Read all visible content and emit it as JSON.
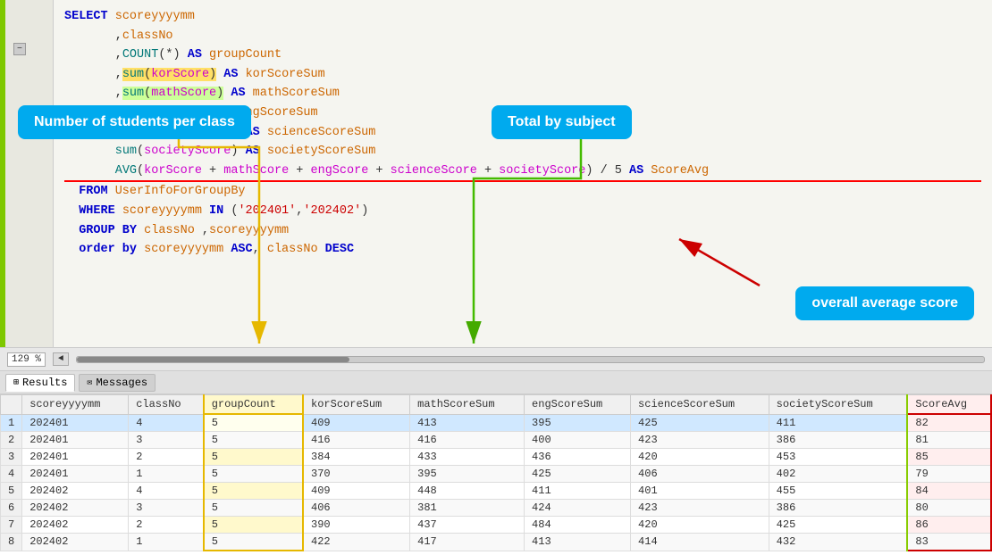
{
  "editor": {
    "zoom": "129 %",
    "sql_lines": [
      {
        "id": "l1",
        "indent": 4,
        "content": "SELECT scoreyyyymm"
      },
      {
        "id": "l2",
        "indent": 7,
        "content": ",classNo"
      },
      {
        "id": "l3",
        "indent": 7,
        "content": ",COUNT(*) AS groupCount"
      },
      {
        "id": "l4",
        "indent": 7,
        "content": ",sum(korScore) AS korScoreSum"
      },
      {
        "id": "l5",
        "indent": 7,
        "content": ",sum(mathScore) AS mathScoreSum"
      },
      {
        "id": "l6",
        "indent": 7,
        "content": ",sum(engScore) AS engScoreSum"
      },
      {
        "id": "l7",
        "indent": 7,
        "content": ",sum(scienceScore) AS scienceScoreSum"
      },
      {
        "id": "l8",
        "indent": 7,
        "content": ",sum(societyScore) AS societyScoreSum"
      },
      {
        "id": "l9",
        "indent": 7,
        "content": ",AVG(korScore + mathScore + engScore + scienceScore + societyScore) / 5 AS ScoreAvg"
      },
      {
        "id": "l10",
        "indent": 2,
        "content": "FROM UserInfoForGroupBy"
      },
      {
        "id": "l11",
        "indent": 2,
        "content": "WHERE scoreyyyymm IN ('202401','202402')"
      },
      {
        "id": "l12",
        "indent": 2,
        "content": "GROUP BY classNo ,scoreyyyymm"
      },
      {
        "id": "l13",
        "indent": 2,
        "content": "order by scoreyyyymm ASC, classNo DESC"
      }
    ]
  },
  "tooltips": {
    "students_per_class": "Number of students per class",
    "total_by_subject": "Total by subject",
    "overall_avg": "overall average score"
  },
  "tabs": {
    "results": "Results",
    "messages": "Messages"
  },
  "table": {
    "headers": [
      "scoreyyyymm",
      "classNo",
      "groupCount",
      "korScoreSum",
      "mathScoreSum",
      "engScoreSum",
      "scienceScoreSum",
      "societyScoreSum",
      "ScoreAvg"
    ],
    "rows": [
      {
        "num": 1,
        "scoreyyyymm": "202401",
        "classNo": "4",
        "groupCount": "5",
        "korScoreSum": "409",
        "mathScoreSum": "413",
        "engScoreSum": "395",
        "scienceScoreSum": "425",
        "societyScoreSum": "411",
        "ScoreAvg": "82"
      },
      {
        "num": 2,
        "scoreyyyymm": "202401",
        "classNo": "3",
        "groupCount": "5",
        "korScoreSum": "416",
        "mathScoreSum": "416",
        "engScoreSum": "400",
        "scienceScoreSum": "423",
        "societyScoreSum": "386",
        "ScoreAvg": "81"
      },
      {
        "num": 3,
        "scoreyyyymm": "202401",
        "classNo": "2",
        "groupCount": "5",
        "korScoreSum": "384",
        "mathScoreSum": "433",
        "engScoreSum": "436",
        "scienceScoreSum": "420",
        "societyScoreSum": "453",
        "ScoreAvg": "85"
      },
      {
        "num": 4,
        "scoreyyyymm": "202401",
        "classNo": "1",
        "groupCount": "5",
        "korScoreSum": "370",
        "mathScoreSum": "395",
        "engScoreSum": "425",
        "scienceScoreSum": "406",
        "societyScoreSum": "402",
        "ScoreAvg": "79"
      },
      {
        "num": 5,
        "scoreyyyymm": "202402",
        "classNo": "4",
        "groupCount": "5",
        "korScoreSum": "409",
        "mathScoreSum": "448",
        "engScoreSum": "411",
        "scienceScoreSum": "401",
        "societyScoreSum": "455",
        "ScoreAvg": "84"
      },
      {
        "num": 6,
        "scoreyyyymm": "202402",
        "classNo": "3",
        "groupCount": "5",
        "korScoreSum": "406",
        "mathScoreSum": "381",
        "engScoreSum": "424",
        "scienceScoreSum": "423",
        "societyScoreSum": "386",
        "ScoreAvg": "80"
      },
      {
        "num": 7,
        "scoreyyyymm": "202402",
        "classNo": "2",
        "groupCount": "5",
        "korScoreSum": "390",
        "mathScoreSum": "437",
        "engScoreSum": "484",
        "scienceScoreSum": "420",
        "societyScoreSum": "425",
        "ScoreAvg": "86"
      },
      {
        "num": 8,
        "scoreyyyymm": "202402",
        "classNo": "1",
        "groupCount": "5",
        "korScoreSum": "422",
        "mathScoreSum": "417",
        "engScoreSum": "413",
        "scienceScoreSum": "414",
        "societyScoreSum": "432",
        "ScoreAvg": "83"
      }
    ]
  }
}
